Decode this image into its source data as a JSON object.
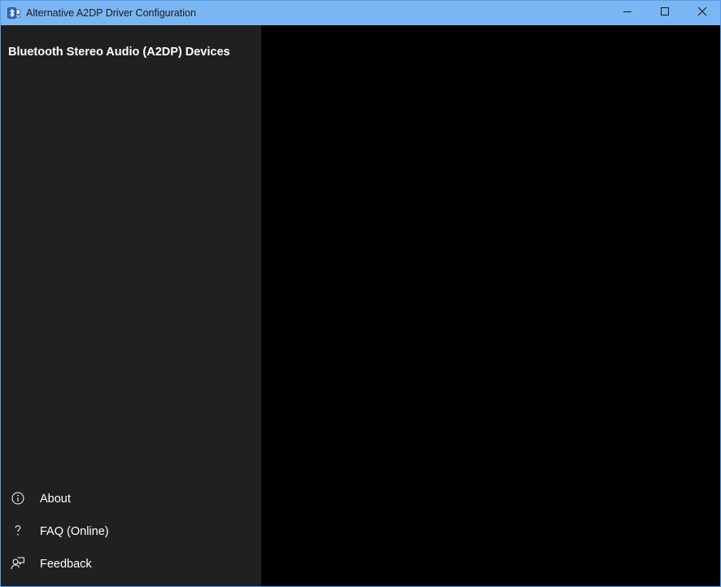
{
  "window": {
    "title": "Alternative A2DP Driver Configuration",
    "accent_color": "#7ab6f4"
  },
  "sidebar": {
    "header": "Bluetooth Stereo Audio (A2DP) Devices",
    "background_color": "#202020",
    "footer_items": [
      {
        "label": "About",
        "icon": "info-icon"
      },
      {
        "label": "FAQ (Online)",
        "icon": "question-icon"
      },
      {
        "label": "Feedback",
        "icon": "feedback-icon"
      }
    ]
  },
  "content": {
    "background_color": "#000000"
  }
}
